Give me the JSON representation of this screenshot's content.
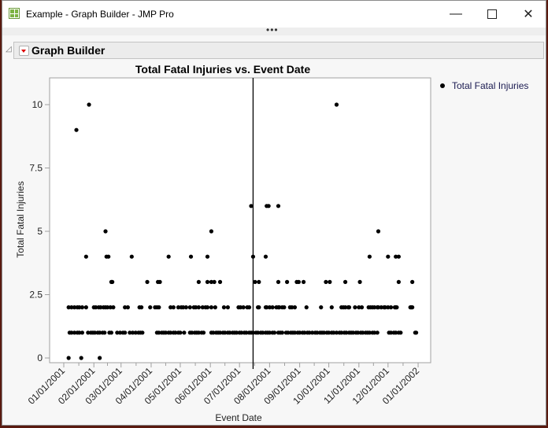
{
  "window": {
    "title": "Example - Graph Builder - JMP Pro",
    "minimize_icon": "minimize-icon",
    "maximize_icon": "maximize-icon",
    "close_icon": "close-icon",
    "overflow_label": "•••"
  },
  "outline": {
    "title": "Graph Builder"
  },
  "legend": {
    "items": [
      {
        "label": "Total Fatal Injuries",
        "color": "#000000"
      }
    ]
  },
  "chart_data": {
    "type": "scatter",
    "title": "Total Fatal Injuries vs. Event Date",
    "xlabel": "Event Date",
    "ylabel": "Total Fatal Injuries",
    "x_units": "days since 01/01/2001",
    "xlim": [
      -15,
      378
    ],
    "ylim": [
      -0.2,
      11
    ],
    "yticks": [
      0,
      2.5,
      5,
      7.5,
      10
    ],
    "ytick_labels": [
      "0",
      "2.5",
      "5",
      "7.5",
      "10"
    ],
    "xticks": [
      0,
      31,
      59,
      90,
      120,
      151,
      181,
      212,
      243,
      273,
      304,
      334,
      365
    ],
    "xtick_labels": [
      "01/01/2001",
      "02/01/2001",
      "03/01/2001",
      "04/01/2001",
      "05/01/2001",
      "06/01/2001",
      "07/01/2001",
      "08/01/2001",
      "09/01/2001",
      "10/01/2001",
      "11/01/2001",
      "12/01/2001",
      "01/01/2002"
    ],
    "reference_line_x": 195,
    "grid": false,
    "legend_position": "right",
    "series": [
      {
        "name": "Total Fatal Injuries",
        "points_by_value": {
          "0": [
            5,
            18,
            37
          ],
          "1": [
            6,
            8,
            11,
            14,
            16,
            19,
            25,
            28,
            30,
            32,
            35,
            37,
            40,
            42,
            47,
            49,
            55,
            58,
            61,
            63,
            68,
            71,
            74,
            77,
            79,
            81,
            96,
            98,
            101,
            103,
            105,
            108,
            110,
            113,
            115,
            118,
            120,
            124,
            130,
            132,
            135,
            137,
            139,
            142,
            144,
            152,
            154,
            157,
            159,
            161,
            164,
            166,
            169,
            171,
            174,
            176,
            178,
            181,
            183,
            186,
            188,
            191,
            193,
            195,
            198,
            200,
            203,
            205,
            208,
            210,
            212,
            215,
            217,
            221,
            223,
            225,
            229,
            231,
            234,
            236,
            238,
            241,
            243,
            246,
            248,
            251,
            253,
            256,
            259,
            261,
            264,
            266,
            268,
            271,
            273,
            276,
            278,
            281,
            284,
            286,
            289,
            291,
            294,
            296,
            298,
            301,
            303,
            306,
            308,
            311,
            313,
            315,
            318,
            320,
            323,
            335,
            337,
            340,
            342,
            345,
            347,
            362,
            363
          ],
          "2": [
            5,
            8,
            11,
            14,
            16,
            19,
            23,
            31,
            33,
            36,
            38,
            41,
            43,
            45,
            48,
            51,
            63,
            66,
            78,
            80,
            89,
            94,
            96,
            98,
            110,
            113,
            118,
            121,
            123,
            126,
            130,
            134,
            136,
            139,
            143,
            146,
            148,
            152,
            156,
            165,
            169,
            180,
            182,
            185,
            189,
            191,
            200,
            201,
            208,
            209,
            212,
            215,
            219,
            221,
            222,
            225,
            227,
            233,
            235,
            238,
            250,
            265,
            276,
            286,
            288,
            290,
            293,
            294,
            300,
            304,
            307,
            314,
            316,
            318,
            320,
            323,
            324,
            327,
            330,
            331,
            334,
            337,
            341,
            342,
            343,
            357,
            358,
            359
          ],
          "3": [
            49,
            50,
            86,
            97,
            99,
            139,
            148,
            152,
            155,
            161,
            197,
            201,
            221,
            230,
            240,
            242,
            247,
            270,
            274,
            290,
            305,
            345,
            359
          ],
          "4": [
            23,
            44,
            46,
            70,
            108,
            131,
            148,
            195,
            208,
            315,
            334,
            342,
            345
          ],
          "5": [
            43,
            152,
            324
          ],
          "6": [
            193,
            209,
            211,
            221
          ],
          "9": [
            13
          ],
          "10": [
            26,
            281
          ]
        }
      }
    ]
  }
}
